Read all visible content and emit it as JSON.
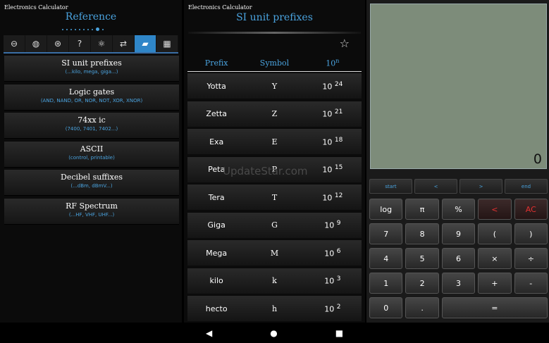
{
  "left": {
    "app_title": "Electronics Calculator",
    "heading": "Reference",
    "page_dots": 10,
    "active_dot": 8,
    "tools": [
      {
        "icon": "resistor-icon",
        "glyph": "⊖"
      },
      {
        "icon": "waveform-icon",
        "glyph": "◍"
      },
      {
        "icon": "ac-dc-icon",
        "glyph": "⊛"
      },
      {
        "icon": "question-icon",
        "glyph": "?"
      },
      {
        "icon": "atom-icon",
        "glyph": "⚛"
      },
      {
        "icon": "swap-arrows-icon",
        "glyph": "⇄"
      },
      {
        "icon": "book-icon",
        "glyph": "▰"
      },
      {
        "icon": "table-icon",
        "glyph": "▦"
      }
    ],
    "active_tool": 6,
    "menu": [
      {
        "title": "SI unit prefixes",
        "sub": "(...kilo, mega, giga...)"
      },
      {
        "title": "Logic gates",
        "sub": "(AND, NAND, OR, NOR, NOT, XOR, XNOR)"
      },
      {
        "title": "74xx ic",
        "sub": "(7400, 7401, 7402...)"
      },
      {
        "title": "ASCII",
        "sub": "(control, printable)"
      },
      {
        "title": "Decibel suffixes",
        "sub": "(...dBm, dBmV...)"
      },
      {
        "title": "RF Spectrum",
        "sub": "(...HF, VHF, UHF...)"
      }
    ]
  },
  "mid": {
    "app_title": "Electronics Calculator",
    "heading": "SI unit prefixes",
    "columns": {
      "prefix": "Prefix",
      "symbol": "Symbol",
      "power_base": "10",
      "power_exp": "n"
    },
    "rows": [
      {
        "prefix": "Yotta",
        "symbol": "Y",
        "base": "10",
        "exp": "24"
      },
      {
        "prefix": "Zetta",
        "symbol": "Z",
        "base": "10",
        "exp": "21"
      },
      {
        "prefix": "Exa",
        "symbol": "E",
        "base": "10",
        "exp": "18"
      },
      {
        "prefix": "Peta",
        "symbol": "P",
        "base": "10",
        "exp": "15"
      },
      {
        "prefix": "Tera",
        "symbol": "T",
        "base": "10",
        "exp": "12"
      },
      {
        "prefix": "Giga",
        "symbol": "G",
        "base": "10",
        "exp": "9"
      },
      {
        "prefix": "Mega",
        "symbol": "M",
        "base": "10",
        "exp": "6"
      },
      {
        "prefix": "kilo",
        "symbol": "k",
        "base": "10",
        "exp": "3"
      },
      {
        "prefix": "hecto",
        "symbol": "h",
        "base": "10",
        "exp": "2"
      }
    ],
    "watermark": "UpdateStar.com"
  },
  "calculator": {
    "display": "0",
    "cursor_buttons": [
      "start",
      "<",
      ">",
      "end"
    ],
    "keys": [
      {
        "label": "log"
      },
      {
        "label": "π"
      },
      {
        "label": "%"
      },
      {
        "label": "<",
        "red": true
      },
      {
        "label": "AC",
        "red": true
      },
      {
        "label": "7"
      },
      {
        "label": "8"
      },
      {
        "label": "9"
      },
      {
        "label": "("
      },
      {
        "label": ")"
      },
      {
        "label": "4"
      },
      {
        "label": "5"
      },
      {
        "label": "6"
      },
      {
        "label": "×"
      },
      {
        "label": "÷"
      },
      {
        "label": "1"
      },
      {
        "label": "2"
      },
      {
        "label": "3"
      },
      {
        "label": "+"
      },
      {
        "label": "-"
      },
      {
        "label": "0"
      },
      {
        "label": "."
      },
      {
        "label": "=",
        "span": 3
      }
    ]
  },
  "navbar": {
    "back": "◀",
    "home": "●",
    "recents": "■"
  },
  "colors": {
    "accent": "#4aa3df",
    "red": "#e23030",
    "display_bg": "#7d8c7a"
  }
}
